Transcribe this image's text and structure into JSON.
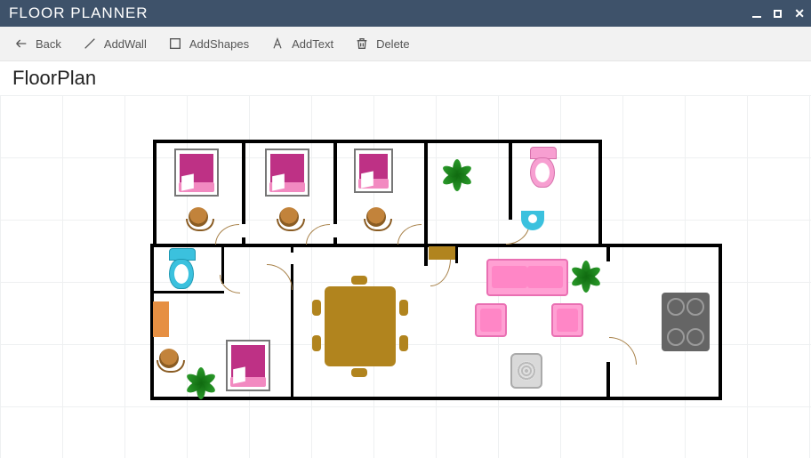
{
  "app": {
    "title": "FLOOR PLANNER"
  },
  "toolbar": {
    "back": "Back",
    "addWall": "AddWall",
    "addShapes": "AddShapes",
    "addText": "AddText",
    "delete": "Delete"
  },
  "document": {
    "title": "FloorPlan"
  }
}
